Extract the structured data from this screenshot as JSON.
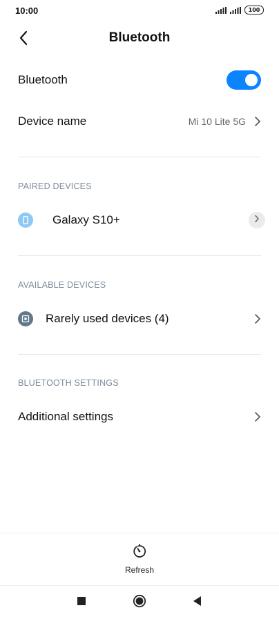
{
  "status_bar": {
    "time": "10:00",
    "battery": "100",
    "icons": [
      "signal-icon",
      "signal-icon",
      "battery-icon"
    ]
  },
  "header": {
    "title": "Bluetooth",
    "back_icon": "back-arrow-icon"
  },
  "bluetooth_toggle": {
    "label": "Bluetooth",
    "state": "on",
    "accent": "#0d84ff"
  },
  "device_name": {
    "label": "Device name",
    "value": "Mi 10 Lite 5G"
  },
  "paired": {
    "header": "PAIRED DEVICES",
    "devices": [
      {
        "name": "Galaxy S10+",
        "icon": "phone-icon"
      }
    ]
  },
  "available": {
    "header": "AVAILABLE DEVICES",
    "items": [
      {
        "label": "Rarely used devices (4)",
        "icon": "device-icon"
      }
    ]
  },
  "settings": {
    "header": "BLUETOOTH SETTINGS",
    "items": [
      {
        "label": "Additional settings"
      }
    ]
  },
  "bottom_bar": {
    "refresh_label": "Refresh",
    "refresh_icon": "refresh-icon"
  },
  "nav": [
    "recents-icon",
    "home-icon",
    "back-icon"
  ],
  "colors": {
    "section_header": "#7c8b9c",
    "divider": "#e6e6e6",
    "paired_icon_bg": "#8fc8f2",
    "available_icon_bg": "#607888"
  }
}
